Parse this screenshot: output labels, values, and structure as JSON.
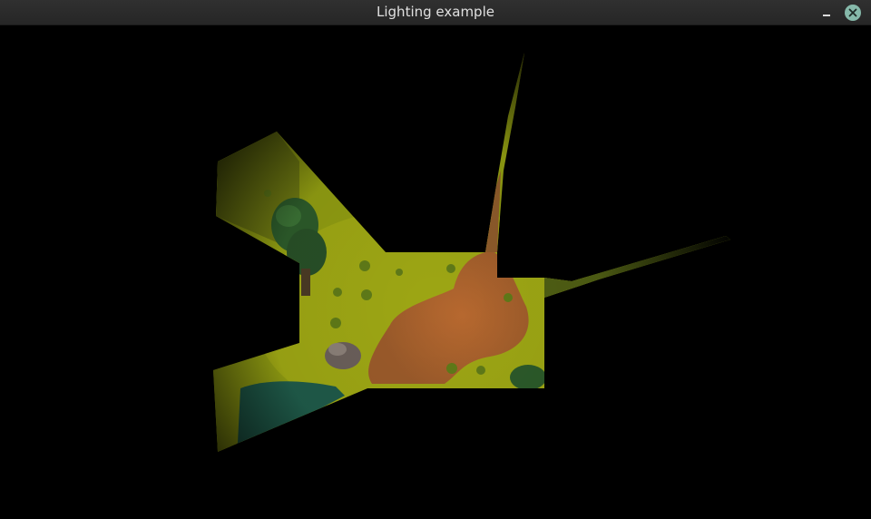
{
  "window": {
    "title": "Lighting example",
    "controls": {
      "minimize_icon": "minimize-icon",
      "close_icon": "close-icon"
    },
    "colors": {
      "titlebar": "#2b2b2b",
      "title_text": "#e0e0e0",
      "close_button": "#86b9aa"
    }
  },
  "scene": {
    "background": "#000000",
    "palette": {
      "grass": "#8f9b12",
      "grass_dark": "#4f5e14",
      "dirt": "#a35f2c",
      "water": "#1f5a49",
      "tree": "#2c5a2a",
      "rock": "#6a5f5a"
    }
  }
}
